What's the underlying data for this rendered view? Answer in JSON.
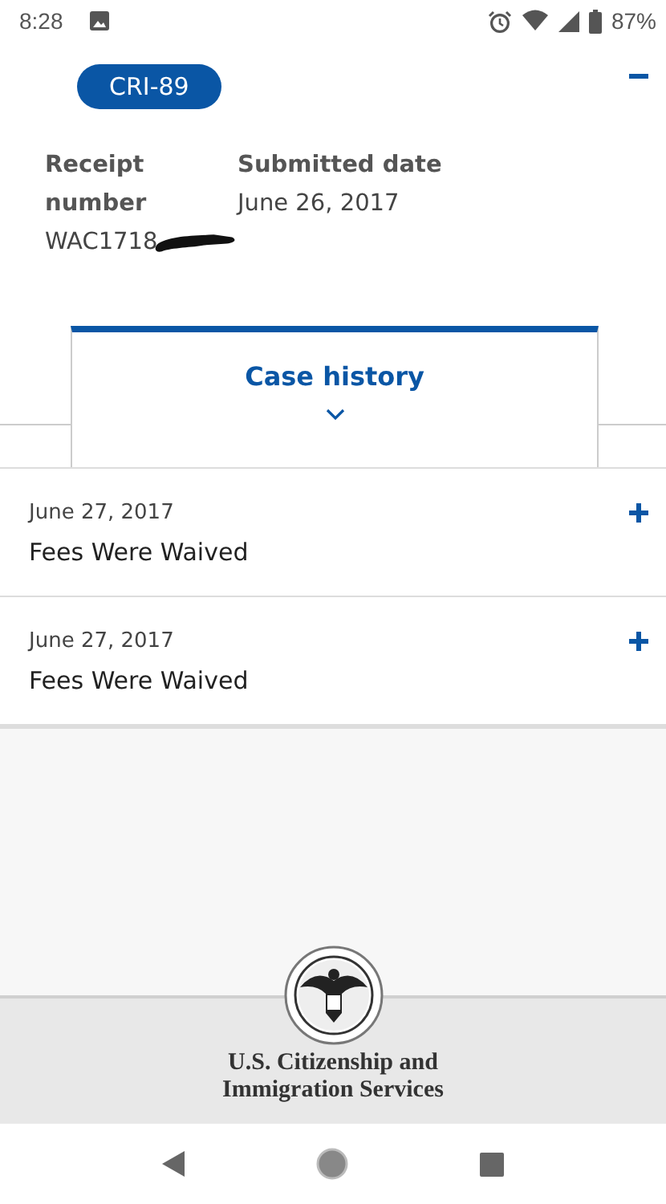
{
  "status_bar": {
    "time": "8:28",
    "battery": "87%"
  },
  "case": {
    "expanded": true,
    "form": "CRI-89",
    "receipt_label": "Receipt number",
    "receipt_value": "WAC1718",
    "submitted_label": "Submitted date",
    "submitted_value": "June 26, 2017"
  },
  "case_history": {
    "label": "Case history",
    "expanded": false
  },
  "entries": [
    {
      "date": "June 27, 2017",
      "title": "Fees Were Waived",
      "expanded": false
    },
    {
      "date": "June 27, 2017",
      "title": "Fees Were Waived",
      "expanded": false
    }
  ],
  "footer": {
    "agency_lines": [
      "U.S. Citizenship and",
      "Immigration Services"
    ]
  }
}
